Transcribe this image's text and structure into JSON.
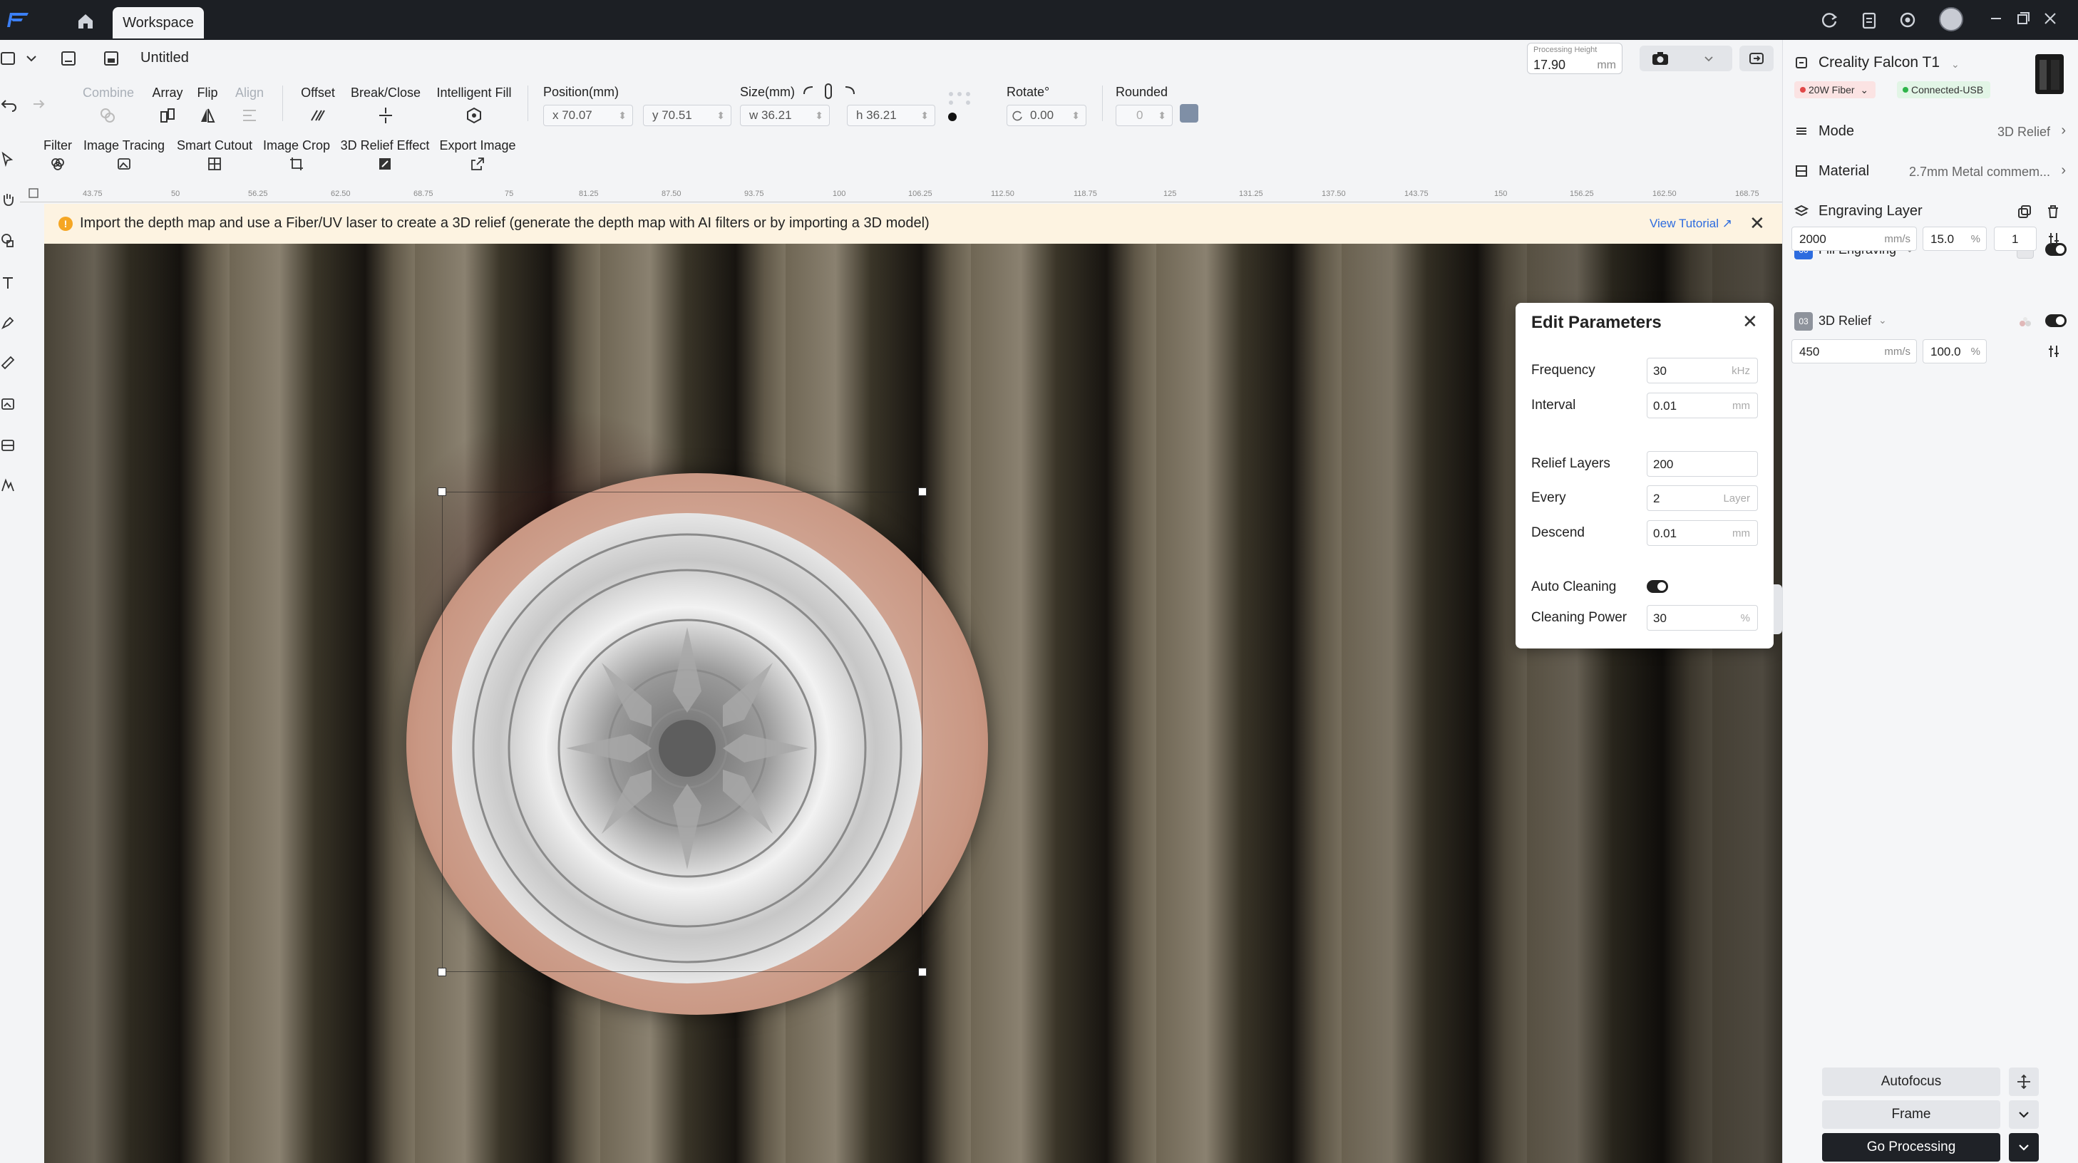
{
  "titlebar": {
    "tab_label": "Workspace"
  },
  "file_row": {
    "doc_title": "Untitled"
  },
  "processing_height": {
    "label": "Processing Height",
    "value": "17.90",
    "unit": "mm"
  },
  "tools_row1": {
    "combine": "Combine",
    "array": "Array",
    "flip": "Flip",
    "align": "Align",
    "offset": "Offset",
    "break_close": "Break/Close",
    "intelligent_fill": "Intelligent Fill"
  },
  "tools_row2": {
    "filter": "Filter",
    "image_tracing": "Image Tracing",
    "smart_cutout": "Smart Cutout",
    "image_crop": "Image Crop",
    "relief_effect": "3D Relief Effect",
    "export_image": "Export Image"
  },
  "position": {
    "label": "Position(mm)",
    "x": "x 70.07",
    "y": "y 70.51"
  },
  "size": {
    "label": "Size(mm)",
    "w": "w 36.21",
    "h": "h 36.21"
  },
  "rotate": {
    "label": "Rotate°",
    "value": "0.00"
  },
  "rounded": {
    "label": "Rounded",
    "value": "0"
  },
  "ruler_ticks": [
    "43.75",
    "50",
    "56.25",
    "62.50",
    "68.75",
    "75",
    "81.25",
    "87.50",
    "93.75",
    "100",
    "106.25",
    "112.50",
    "118.75",
    "125",
    "131.25",
    "137.50",
    "143.75",
    "150",
    "156.25",
    "162.50",
    "168.75"
  ],
  "notice": {
    "text": "Import the depth map and use a Fiber/UV laser to create a 3D relief (generate the depth map with AI filters or by importing a 3D model)",
    "link": "View Tutorial ↗"
  },
  "edit_params": {
    "title": "Edit Parameters",
    "frequency": {
      "label": "Frequency",
      "value": "30",
      "unit": "kHz"
    },
    "interval": {
      "label": "Interval",
      "value": "0.01",
      "unit": "mm"
    },
    "relief_layers": {
      "label": "Relief Layers",
      "value": "200"
    },
    "every": {
      "label": "Every",
      "value": "2",
      "unit": "Layer"
    },
    "descend": {
      "label": "Descend",
      "value": "0.01",
      "unit": "mm"
    },
    "auto_cleaning": {
      "label": "Auto Cleaning",
      "on": true
    },
    "cleaning_power": {
      "label": "Cleaning Power",
      "value": "30",
      "unit": "%"
    }
  },
  "device": {
    "name": "Creality Falcon T1",
    "laser": "20W Fiber",
    "connection": "Connected-USB"
  },
  "mode": {
    "label": "Mode",
    "value": "3D Relief"
  },
  "material": {
    "label": "Material",
    "value": "2.7mm Metal commem..."
  },
  "engraving_layer": {
    "label": "Engraving Layer"
  },
  "layers": [
    {
      "badge": "00",
      "name": "Fill Engraving",
      "speed": "2000",
      "speed_unit": "mm/s",
      "power": "15.0",
      "power_unit": "%",
      "passes": "1",
      "badge_color": "#2d6cdf"
    },
    {
      "badge": "03",
      "name": "3D Relief",
      "speed": "450",
      "speed_unit": "mm/s",
      "power": "100.0",
      "power_unit": "%",
      "badge_color": "#8e939c"
    }
  ],
  "bottom_buttons": {
    "autofocus": "Autofocus",
    "frame": "Frame",
    "go_processing": "Go Processing"
  },
  "colors": {
    "accent": "#2d6cdf",
    "titlebar": "#1c1f24",
    "notice_bg": "#fdf3e1",
    "go_button": "#1f2227"
  }
}
